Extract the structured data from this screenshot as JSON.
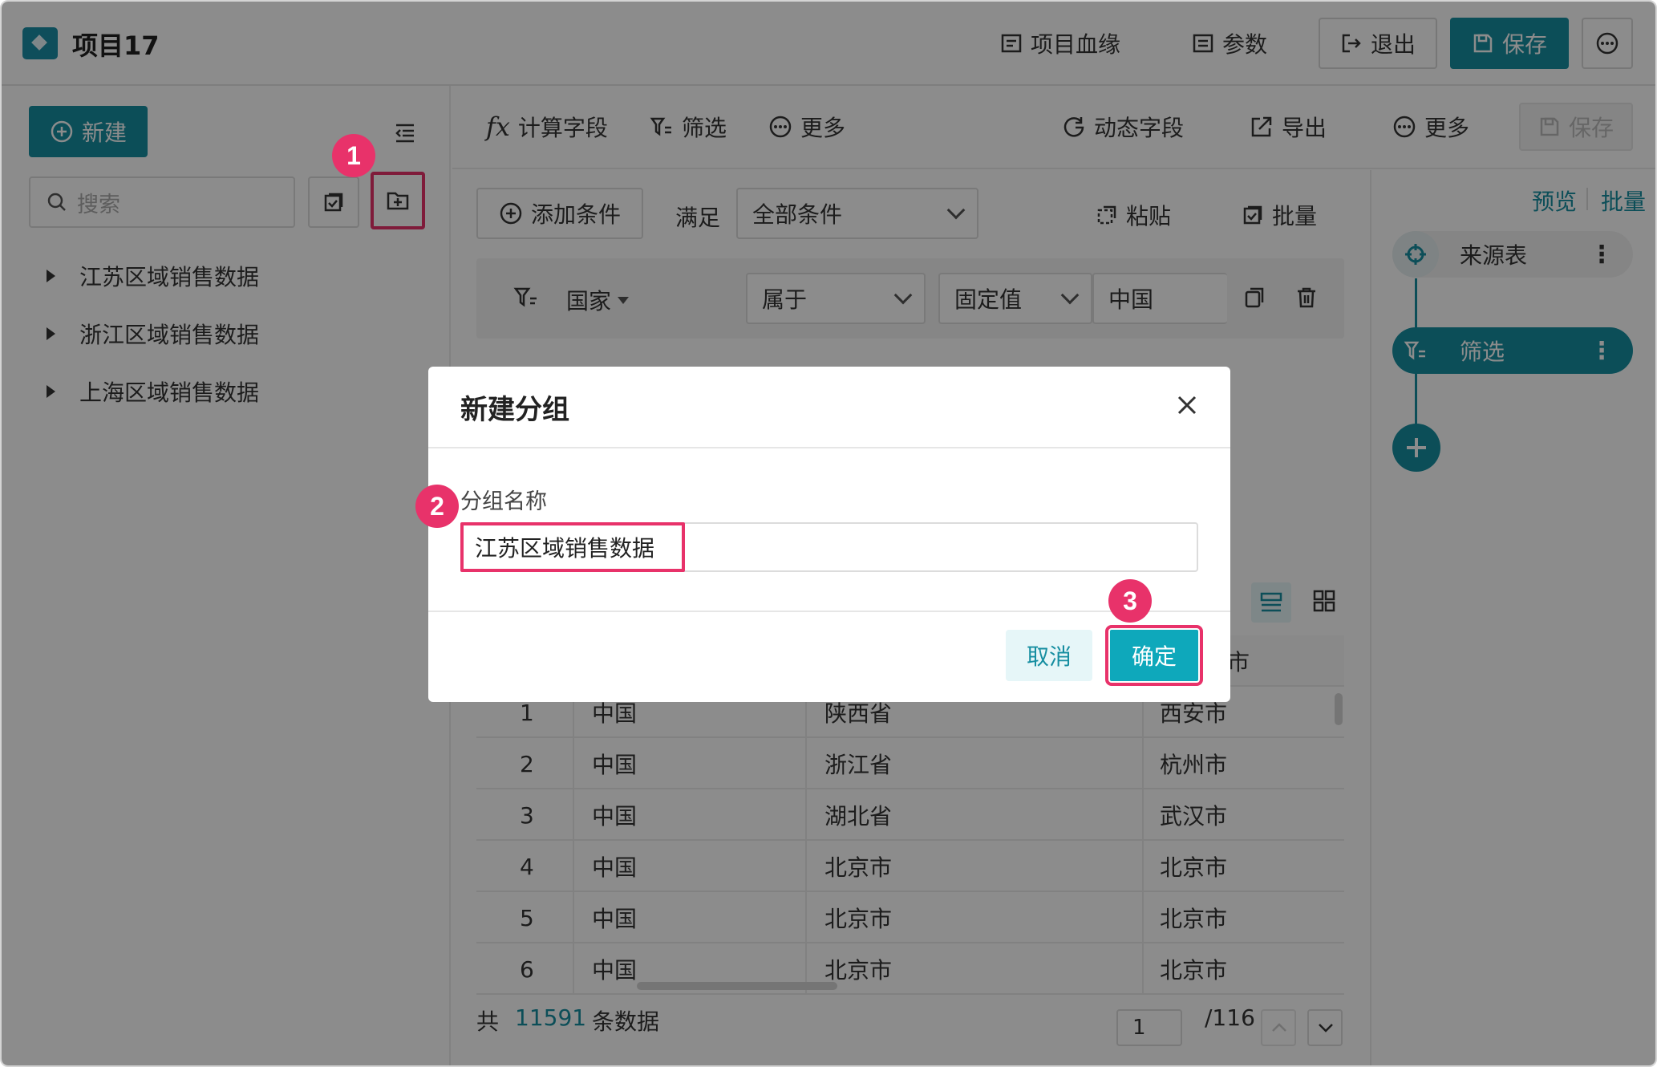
{
  "app": {
    "title": "项目17",
    "top_actions": {
      "lineage": "项目血缘",
      "params": "参数",
      "exit": "退出",
      "save": "保存"
    }
  },
  "sidebar": {
    "new_label": "新建",
    "search_placeholder": "搜索",
    "tree": [
      "江苏区域销售数据",
      "浙江区域销售数据",
      "上海区域销售数据"
    ]
  },
  "toolbar": {
    "calc_field": "计算字段",
    "filter": "筛选",
    "more_left": "更多",
    "dynamic_field": "动态字段",
    "export": "导出",
    "more_right": "更多",
    "save": "保存"
  },
  "condition": {
    "add": "添加条件",
    "satisfy": "满足",
    "mode": "全部条件",
    "paste": "粘贴",
    "batch": "批量",
    "field": "国家",
    "operator": "属于",
    "value_type": "固定值",
    "value": "中国"
  },
  "flow": {
    "preview": "预览",
    "batch": "批量",
    "nodes": [
      "来源表",
      "筛选"
    ]
  },
  "table": {
    "header_last": "市",
    "rows": [
      [
        "1",
        "中国",
        "陕西省",
        "西安市"
      ],
      [
        "2",
        "中国",
        "浙江省",
        "杭州市"
      ],
      [
        "3",
        "中国",
        "湖北省",
        "武汉市"
      ],
      [
        "4",
        "中国",
        "北京市",
        "北京市"
      ],
      [
        "5",
        "中国",
        "北京市",
        "北京市"
      ],
      [
        "6",
        "中国",
        "北京市",
        "北京市"
      ]
    ]
  },
  "footer": {
    "prefix": "共",
    "count": "11591",
    "suffix": "条数据",
    "page": "1",
    "total_pages": "/116"
  },
  "modal": {
    "title": "新建分组",
    "field_label": "分组名称",
    "field_value": "江苏区域销售数据",
    "cancel": "取消",
    "ok": "确定"
  },
  "steps": [
    "1",
    "2",
    "3"
  ],
  "colors": {
    "primary": "#168ea1",
    "highlight": "#e8326a",
    "ok_button": "#0ea8bb"
  }
}
